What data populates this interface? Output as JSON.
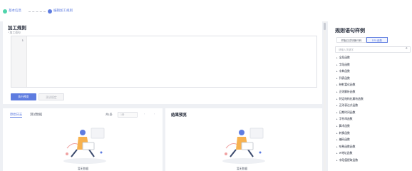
{
  "steps": [
    {
      "label": "基本信息",
      "state": "done"
    },
    {
      "label": "编辑加工规则",
      "state": "active"
    }
  ],
  "editor": {
    "section_title": "加工规则",
    "field_label": "* 加工语句",
    "line_number": "1"
  },
  "actions": {
    "run_label": "执行预览",
    "test_label": "测试规定"
  },
  "data_panel": {
    "tabs": [
      "原始日志",
      "测试数据"
    ],
    "pager_total": "共1条",
    "pager_size": "1条",
    "empty_text": "暂无数据"
  },
  "preview_panel": {
    "title": "结果预览",
    "empty_text": "暂无数据"
  },
  "sample_panel": {
    "title": "规则语句样例",
    "segments": [
      "样板日志场景代码",
      "DSL函数"
    ],
    "search_placeholder": "请输入关键字",
    "functions": [
      "全局函数",
      "字段函数",
      "字典函数",
      "列表函数",
      "映射富化函数",
      "正则解析函数",
      "特定结构化解析函数",
      "正则表达式函数",
      "日期时间函数",
      "字符串函数",
      "算术函数",
      "转换函数",
      "编码函数",
      "哈希函数函数",
      "IP地址函数",
      "字段值提取函数"
    ]
  },
  "colors": {
    "accent": "#5e7ce0",
    "success": "#50d4ab",
    "page_bg": "#eef0f4"
  }
}
